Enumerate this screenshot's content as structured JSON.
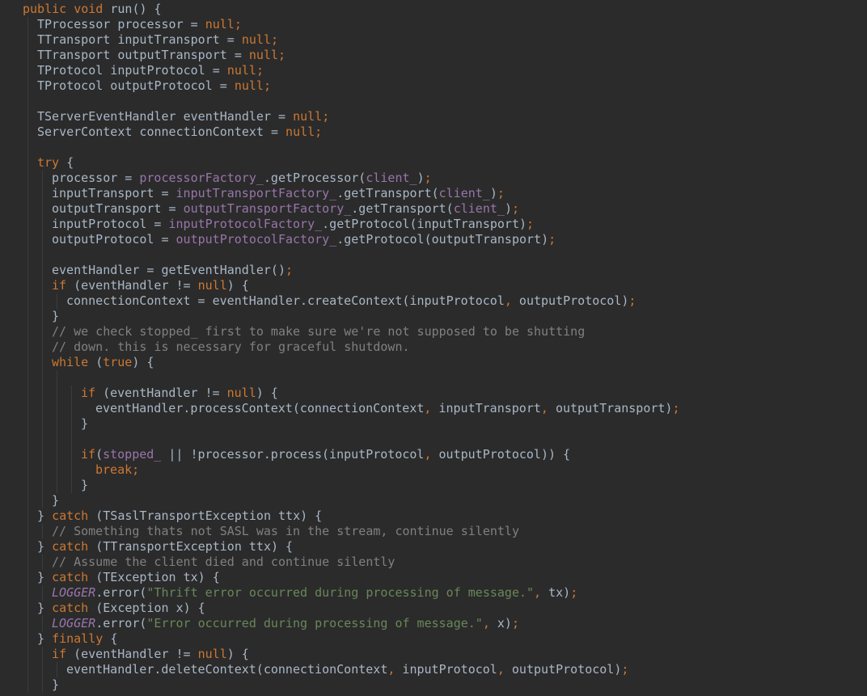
{
  "editor": {
    "language": "java",
    "colors": {
      "background": "#2b2b2b",
      "text": "#a9b7c6",
      "kw": "#cc7832",
      "field": "#9876aa",
      "static": "#9876aa",
      "str": "#6a8759",
      "comment": "#808080",
      "indent_guide": "#3b3b3b"
    },
    "lines": [
      {
        "indent": 0,
        "tokens": [
          [
            "kw",
            "public void "
          ],
          [
            "text",
            "run() {"
          ]
        ]
      },
      {
        "indent": 1,
        "tokens": [
          [
            "text",
            "TProcessor processor = "
          ],
          [
            "kw",
            "null"
          ],
          [
            "kw",
            ";"
          ]
        ]
      },
      {
        "indent": 1,
        "tokens": [
          [
            "text",
            "TTransport inputTransport = "
          ],
          [
            "kw",
            "null"
          ],
          [
            "kw",
            ";"
          ]
        ]
      },
      {
        "indent": 1,
        "tokens": [
          [
            "text",
            "TTransport outputTransport = "
          ],
          [
            "kw",
            "null"
          ],
          [
            "kw",
            ";"
          ]
        ]
      },
      {
        "indent": 1,
        "tokens": [
          [
            "text",
            "TProtocol inputProtocol = "
          ],
          [
            "kw",
            "null"
          ],
          [
            "kw",
            ";"
          ]
        ]
      },
      {
        "indent": 1,
        "tokens": [
          [
            "text",
            "TProtocol outputProtocol = "
          ],
          [
            "kw",
            "null"
          ],
          [
            "kw",
            ";"
          ]
        ]
      },
      {
        "indent": 1,
        "tokens": []
      },
      {
        "indent": 1,
        "tokens": [
          [
            "text",
            "TServerEventHandler eventHandler = "
          ],
          [
            "kw",
            "null"
          ],
          [
            "kw",
            ";"
          ]
        ]
      },
      {
        "indent": 1,
        "tokens": [
          [
            "text",
            "ServerContext connectionContext = "
          ],
          [
            "kw",
            "null"
          ],
          [
            "kw",
            ";"
          ]
        ]
      },
      {
        "indent": 1,
        "tokens": []
      },
      {
        "indent": 1,
        "tokens": [
          [
            "kw",
            "try "
          ],
          [
            "text",
            "{"
          ]
        ]
      },
      {
        "indent": 2,
        "tokens": [
          [
            "text",
            "processor = "
          ],
          [
            "field",
            "processorFactory_"
          ],
          [
            "text",
            ".getProcessor("
          ],
          [
            "field",
            "client_"
          ],
          [
            "text",
            ")"
          ],
          [
            "kw",
            ";"
          ]
        ]
      },
      {
        "indent": 2,
        "tokens": [
          [
            "text",
            "inputTransport = "
          ],
          [
            "field",
            "inputTransportFactory_"
          ],
          [
            "text",
            ".getTransport("
          ],
          [
            "field",
            "client_"
          ],
          [
            "text",
            ")"
          ],
          [
            "kw",
            ";"
          ]
        ]
      },
      {
        "indent": 2,
        "tokens": [
          [
            "text",
            "outputTransport = "
          ],
          [
            "field",
            "outputTransportFactory_"
          ],
          [
            "text",
            ".getTransport("
          ],
          [
            "field",
            "client_"
          ],
          [
            "text",
            ")"
          ],
          [
            "kw",
            ";"
          ]
        ]
      },
      {
        "indent": 2,
        "tokens": [
          [
            "text",
            "inputProtocol = "
          ],
          [
            "field",
            "inputProtocolFactory_"
          ],
          [
            "text",
            ".getProtocol(inputTransport)"
          ],
          [
            "kw",
            ";"
          ]
        ]
      },
      {
        "indent": 2,
        "tokens": [
          [
            "text",
            "outputProtocol = "
          ],
          [
            "field",
            "outputProtocolFactory_"
          ],
          [
            "text",
            ".getProtocol(outputTransport)"
          ],
          [
            "kw",
            ";"
          ]
        ]
      },
      {
        "indent": 2,
        "tokens": []
      },
      {
        "indent": 2,
        "tokens": [
          [
            "text",
            "eventHandler = getEventHandler()"
          ],
          [
            "kw",
            ";"
          ]
        ]
      },
      {
        "indent": 2,
        "tokens": [
          [
            "kw",
            "if "
          ],
          [
            "text",
            "(eventHandler != "
          ],
          [
            "kw",
            "null"
          ],
          [
            "text",
            ") {"
          ]
        ]
      },
      {
        "indent": 3,
        "tokens": [
          [
            "text",
            "connectionContext = eventHandler.createContext(inputProtocol"
          ],
          [
            "kw",
            ", "
          ],
          [
            "text",
            "outputProtocol)"
          ],
          [
            "kw",
            ";"
          ]
        ]
      },
      {
        "indent": 2,
        "tokens": [
          [
            "text",
            "}"
          ]
        ]
      },
      {
        "indent": 2,
        "tokens": [
          [
            "comment",
            "// we check stopped_ first to make sure we're not supposed to be shutting"
          ]
        ]
      },
      {
        "indent": 2,
        "tokens": [
          [
            "comment",
            "// down. this is necessary for graceful shutdown."
          ]
        ]
      },
      {
        "indent": 2,
        "tokens": [
          [
            "kw",
            "while "
          ],
          [
            "text",
            "("
          ],
          [
            "kw",
            "true"
          ],
          [
            "text",
            ") {"
          ]
        ]
      },
      {
        "indent": 3,
        "tokens": []
      },
      {
        "indent": 4,
        "tokens": [
          [
            "kw",
            "if "
          ],
          [
            "text",
            "(eventHandler != "
          ],
          [
            "kw",
            "null"
          ],
          [
            "text",
            ") {"
          ]
        ]
      },
      {
        "indent": 5,
        "tokens": [
          [
            "text",
            "eventHandler.processContext(connectionContext"
          ],
          [
            "kw",
            ", "
          ],
          [
            "text",
            "inputTransport"
          ],
          [
            "kw",
            ", "
          ],
          [
            "text",
            "outputTransport)"
          ],
          [
            "kw",
            ";"
          ]
        ]
      },
      {
        "indent": 4,
        "tokens": [
          [
            "text",
            "}"
          ]
        ]
      },
      {
        "indent": 4,
        "tokens": []
      },
      {
        "indent": 4,
        "tokens": [
          [
            "kw",
            "if"
          ],
          [
            "text",
            "("
          ],
          [
            "field",
            "stopped_"
          ],
          [
            "text",
            " || !processor.process(inputProtocol"
          ],
          [
            "kw",
            ", "
          ],
          [
            "text",
            "outputProtocol)) {"
          ]
        ]
      },
      {
        "indent": 5,
        "tokens": [
          [
            "kw",
            "break;"
          ]
        ]
      },
      {
        "indent": 4,
        "tokens": [
          [
            "text",
            "}"
          ]
        ]
      },
      {
        "indent": 2,
        "tokens": [
          [
            "text",
            "}"
          ]
        ]
      },
      {
        "indent": 1,
        "tokens": [
          [
            "text",
            "} "
          ],
          [
            "kw",
            "catch "
          ],
          [
            "text",
            "(TSaslTransportException ttx) {"
          ]
        ]
      },
      {
        "indent": 2,
        "tokens": [
          [
            "comment",
            "// Something thats not SASL was in the stream, continue silently"
          ]
        ]
      },
      {
        "indent": 1,
        "tokens": [
          [
            "text",
            "} "
          ],
          [
            "kw",
            "catch "
          ],
          [
            "text",
            "(TTransportException ttx) {"
          ]
        ]
      },
      {
        "indent": 2,
        "tokens": [
          [
            "comment",
            "// Assume the client died and continue silently"
          ]
        ]
      },
      {
        "indent": 1,
        "tokens": [
          [
            "text",
            "} "
          ],
          [
            "kw",
            "catch "
          ],
          [
            "text",
            "(TException tx) {"
          ]
        ]
      },
      {
        "indent": 2,
        "tokens": [
          [
            "static",
            "LOGGER"
          ],
          [
            "text",
            ".error("
          ],
          [
            "str",
            "\"Thrift error occurred during processing of message.\""
          ],
          [
            "kw",
            ", "
          ],
          [
            "text",
            "tx)"
          ],
          [
            "kw",
            ";"
          ]
        ]
      },
      {
        "indent": 1,
        "tokens": [
          [
            "text",
            "} "
          ],
          [
            "kw",
            "catch "
          ],
          [
            "text",
            "(Exception x) {"
          ]
        ]
      },
      {
        "indent": 2,
        "tokens": [
          [
            "static",
            "LOGGER"
          ],
          [
            "text",
            ".error("
          ],
          [
            "str",
            "\"Error occurred during processing of message.\""
          ],
          [
            "kw",
            ", "
          ],
          [
            "text",
            "x)"
          ],
          [
            "kw",
            ";"
          ]
        ]
      },
      {
        "indent": 1,
        "tokens": [
          [
            "text",
            "} "
          ],
          [
            "kw",
            "finally "
          ],
          [
            "text",
            "{"
          ]
        ]
      },
      {
        "indent": 2,
        "tokens": [
          [
            "kw",
            "if "
          ],
          [
            "text",
            "(eventHandler != "
          ],
          [
            "kw",
            "null"
          ],
          [
            "text",
            ") {"
          ]
        ]
      },
      {
        "indent": 3,
        "tokens": [
          [
            "text",
            "eventHandler.deleteContext(connectionContext"
          ],
          [
            "kw",
            ", "
          ],
          [
            "text",
            "inputProtocol"
          ],
          [
            "kw",
            ", "
          ],
          [
            "text",
            "outputProtocol)"
          ],
          [
            "kw",
            ";"
          ]
        ]
      },
      {
        "indent": 2,
        "tokens": [
          [
            "text",
            "}"
          ]
        ]
      }
    ]
  }
}
